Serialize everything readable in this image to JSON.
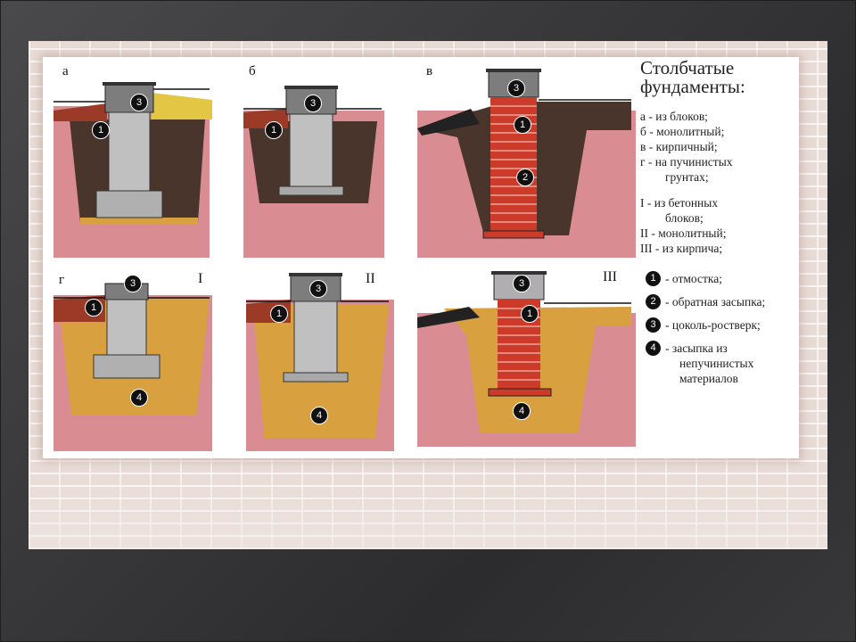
{
  "legend": {
    "title_line1": "Столбчатые",
    "title_line2": "фундаменты:",
    "types": [
      "а - из блоков;",
      "б - монолитный;",
      "в - кирпичный;",
      "г - на пучинистых",
      "грунтах;"
    ],
    "materials": [
      "I - из бетонных",
      "блоков;",
      "II - монолитный;",
      "III - из кирпича;"
    ],
    "keys": [
      {
        "num": "1",
        "text": "- отмостка;"
      },
      {
        "num": "2",
        "text": "- обратная засыпка;"
      },
      {
        "num": "3",
        "text": "- цоколь-ростверк;"
      },
      {
        "num": "4",
        "text": "- засыпка из"
      }
    ],
    "key4_cont1": "непучинистых",
    "key4_cont2": "материалов"
  },
  "panels": {
    "a": "а",
    "b": "б",
    "v": "в",
    "g": "г",
    "roman1": "I",
    "roman2": "II",
    "roman3": "III"
  },
  "markers": {
    "m1": "1",
    "m2": "2",
    "m3": "3",
    "m4": "4"
  },
  "colors": {
    "soil_pink": "#d98c92",
    "soil_dark": "#4a352c",
    "sand": "#d9a040",
    "brick": "#cc3b2a",
    "concrete": "#b8b8b8",
    "plinth": "#7d7d7d"
  }
}
